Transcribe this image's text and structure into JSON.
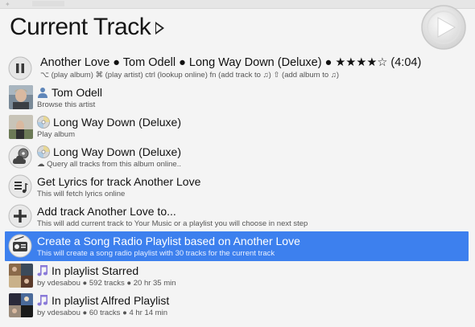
{
  "header": {
    "title": "Current Track"
  },
  "now_playing": {
    "title_line": "Another Love ● Tom Odell ● Long Way Down (Deluxe) ● ★★★★☆ (4:04)",
    "hint_line": "⌥ (play album) ⌘ (play artist) ctrl (lookup online) fn (add track to ♫) ⇧ (add album to ♫)"
  },
  "rows": [
    {
      "title": "Tom Odell",
      "subtitle": "Browse this artist"
    },
    {
      "title": "Long Way Down (Deluxe)",
      "subtitle": "Play album"
    },
    {
      "title": "Long Way Down (Deluxe)",
      "subtitle": "Query all tracks from this album online.."
    },
    {
      "title": "Get Lyrics for track Another Love",
      "subtitle": "This will fetch lyrics online"
    },
    {
      "title": "Add track Another Love to...",
      "subtitle": "This will add current track to Your Music or a playlist you will choose in next step"
    },
    {
      "title": "Create a Song Radio Playlist based on Another Love",
      "subtitle": "This will create a song radio playlist with 30 tracks for the current track"
    },
    {
      "title": "In playlist Starred",
      "subtitle": "by vdesabou ● 592 tracks ● 20 hr 35 min"
    },
    {
      "title": "In playlist Alfred Playlist",
      "subtitle": "by vdesabou ● 60 tracks ● 4 hr 14 min"
    }
  ],
  "selected_index": 5,
  "colors": {
    "selection": "#3d80ee",
    "background": "#f4f4f4"
  },
  "icons": [
    "pause-icon",
    "artist-photo",
    "person-icon",
    "album-art",
    "cd-icon",
    "cloud-cd-icon",
    "lyrics-icon",
    "add-icon",
    "radio-icon",
    "playlist-cover",
    "music-note-icon",
    "play-icon"
  ]
}
